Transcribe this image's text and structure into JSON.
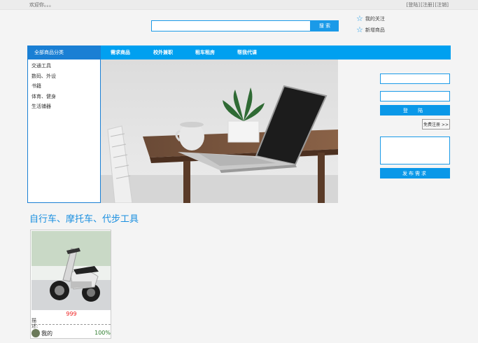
{
  "topbar": {
    "welcome": "欢迎你。。。",
    "login_link": "[登陆]",
    "register_link": "[注册]",
    "logout_link": "[注销]"
  },
  "search": {
    "placeholder": "",
    "button_label": "搜 索"
  },
  "favorites": {
    "my_follow": "我的关注",
    "new_items": "新增商品",
    "icon": "star-outline-icon"
  },
  "nav": {
    "all_categories": "全部商品分类",
    "items": [
      "需求商品",
      "校外兼职",
      "租车租房",
      "帮我代课"
    ]
  },
  "categories": [
    "交通工具",
    "数码、外设",
    "书籍",
    "体育、健身",
    "生活铺器"
  ],
  "login": {
    "login_button": "登  陆",
    "register_button": "免费注册 >>",
    "demand_button": "发布需求"
  },
  "section": {
    "title": "自行车、摩托车、代步工具"
  },
  "products": [
    {
      "price": "999",
      "desc_label": "描述:",
      "owner": "我的",
      "percent": "100%"
    }
  ],
  "colors": {
    "accent": "#00a0f0",
    "nav_dark": "#1a7fd4",
    "price": "#e22222",
    "percent": "#2a7a2a"
  }
}
